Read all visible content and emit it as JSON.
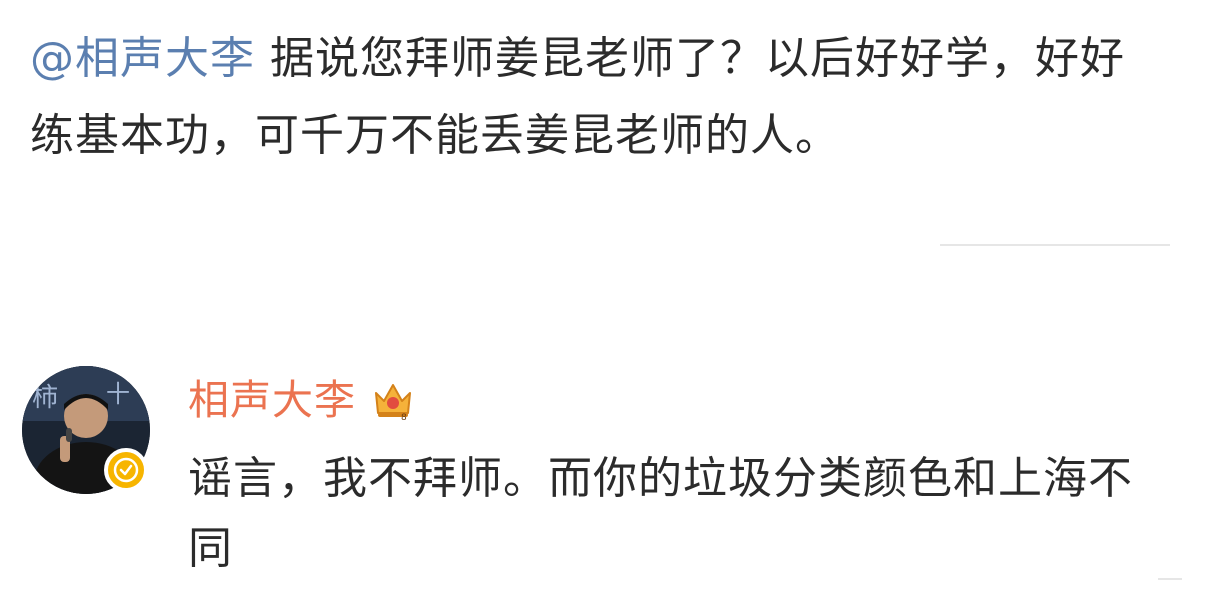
{
  "comment": {
    "mention": "@相声大李",
    "text": " 据说您拜师姜昆老师了？以后好好学，好好练基本功，可千万不能丢姜昆老师的人。"
  },
  "reply": {
    "author": "相声大李",
    "text": "谣言，我不拜师。而你的垃圾分类颜色和上海不同",
    "badge_color": "#f7b500",
    "author_color": "#eb7350",
    "icons": [
      "avatar",
      "verified-badge-icon",
      "crown-icon"
    ]
  },
  "colors": {
    "mention": "#5b7fb0",
    "text": "#2b2b2b"
  }
}
